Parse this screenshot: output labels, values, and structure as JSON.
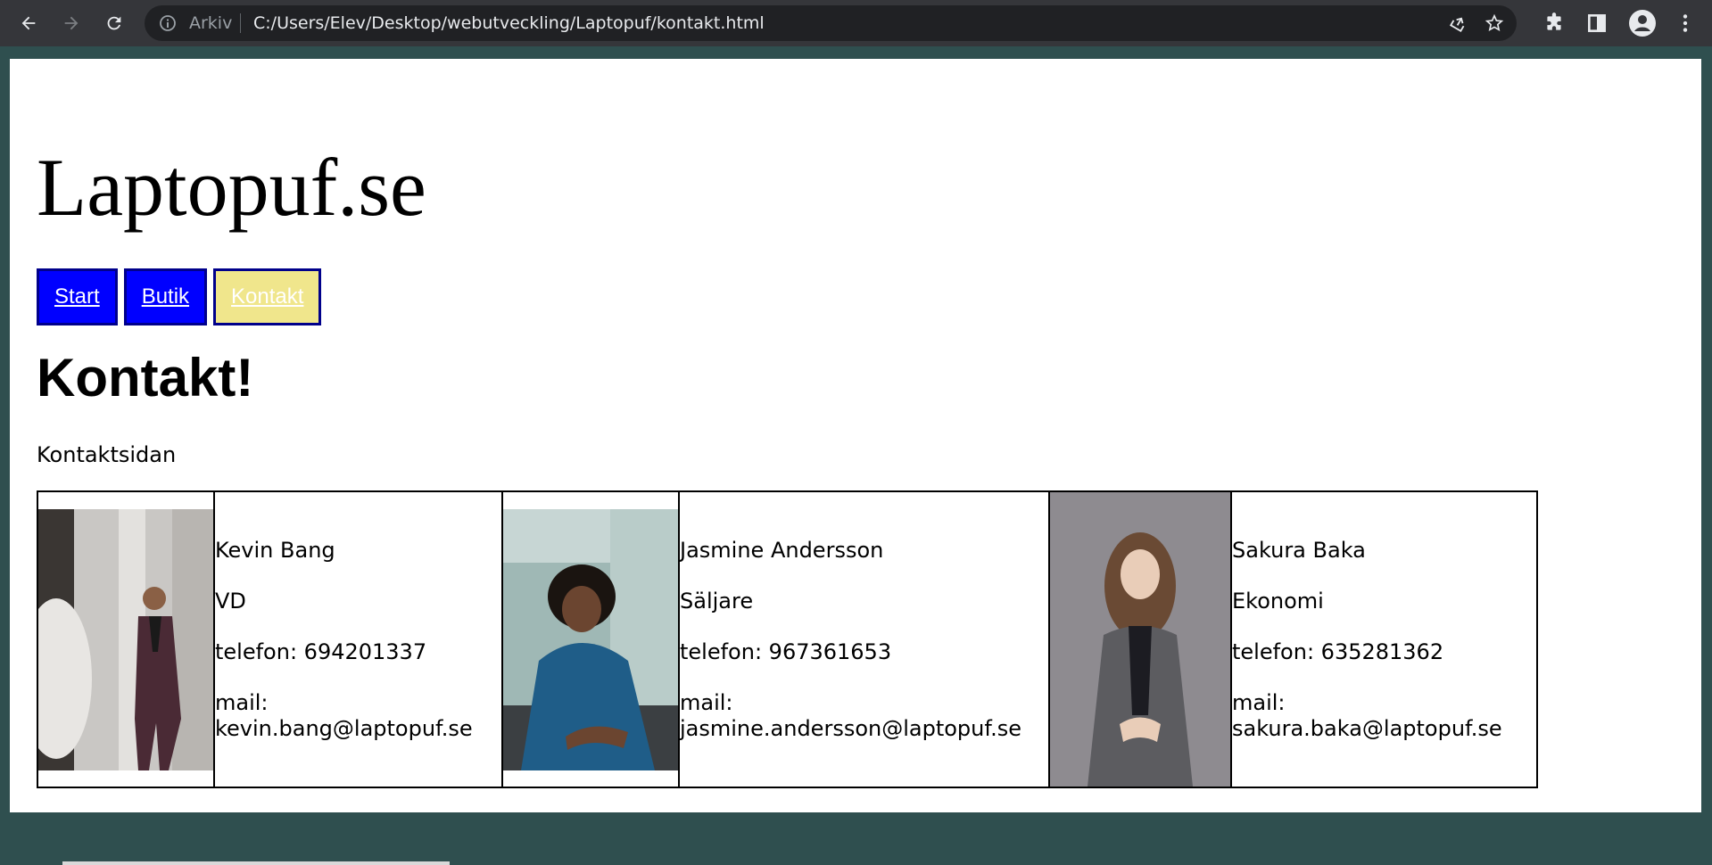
{
  "browser": {
    "scheme_label": "Arkiv",
    "url": "C:/Users/Elev/Desktop/webutveckling/Laptopuf/kontakt.html",
    "icons": [
      "back-icon",
      "forward-icon",
      "reload-icon",
      "info-icon",
      "share-icon",
      "star-icon",
      "extensions-icon",
      "side-panel-icon",
      "profile-icon",
      "menu-icon"
    ]
  },
  "site": {
    "title": "Laptopuf.se",
    "nav": [
      "Start",
      "Butik",
      "Kontakt"
    ],
    "active_nav": "Kontakt",
    "heading": "Kontakt!",
    "intro": "Kontaktsidan"
  },
  "contacts": [
    {
      "name": "Kevin Bang",
      "role": "VD",
      "phone": "telefon: 694201337",
      "mail_label": "mail:",
      "mail": "kevin.bang@laptopuf.se"
    },
    {
      "name": "Jasmine Andersson",
      "role": "Säljare",
      "phone": "telefon: 967361653",
      "mail_label": "mail:",
      "mail": "jasmine.andersson@laptopuf.se"
    },
    {
      "name": "Sakura Baka",
      "role": "Ekonomi",
      "phone": "telefon: 635281362",
      "mail_label": "mail:",
      "mail": "sakura.baka@laptopuf.se"
    }
  ],
  "colors": {
    "nav_bg": "#0000ff",
    "nav_active_bg": "#f0e68c",
    "page_bg": "#2f4f4f"
  }
}
